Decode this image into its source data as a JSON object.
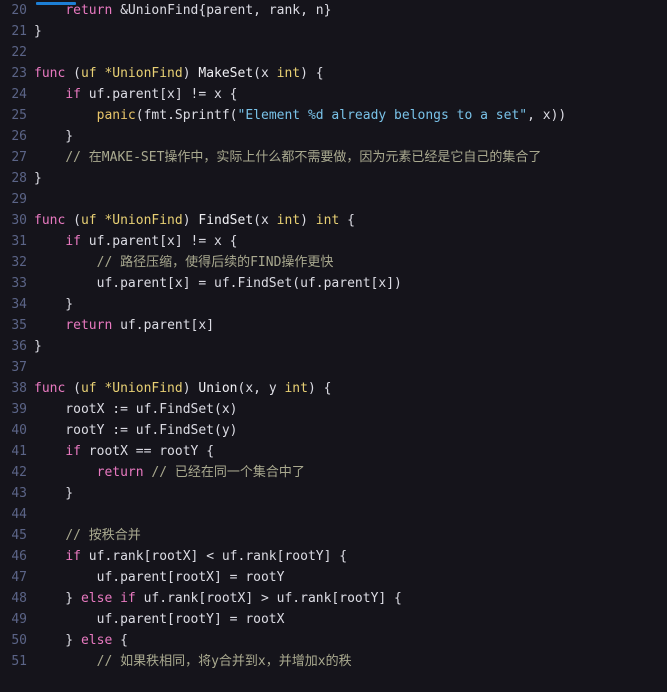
{
  "editor": {
    "language": "go",
    "theme": "dark",
    "colors": {
      "background": "#15141b",
      "line_number": "#5b6487",
      "keyword": "#e879c0",
      "type": "#e8d074",
      "builtin_function": "#e8c56a",
      "string": "#79c2e8",
      "comment": "#a9a98f",
      "plain": "#dcdce4",
      "marker_bar": "#1d7fd6"
    },
    "first_visible_line": 20,
    "last_visible_line": 51
  },
  "lines": [
    {
      "n": "20",
      "tokens": [
        {
          "t": "    ",
          "c": "pln"
        },
        {
          "t": "return",
          "c": "kw"
        },
        {
          "t": " &UnionFind{parent, rank, n}",
          "c": "pln"
        }
      ]
    },
    {
      "n": "21",
      "tokens": [
        {
          "t": "}",
          "c": "pln"
        }
      ]
    },
    {
      "n": "22",
      "tokens": []
    },
    {
      "n": "23",
      "tokens": [
        {
          "t": "func",
          "c": "kw"
        },
        {
          "t": " (",
          "c": "pln"
        },
        {
          "t": "uf *UnionFind",
          "c": "typ"
        },
        {
          "t": ") ",
          "c": "pln"
        },
        {
          "t": "MakeSet",
          "c": "fn"
        },
        {
          "t": "(x ",
          "c": "pln"
        },
        {
          "t": "int",
          "c": "typ"
        },
        {
          "t": ") {",
          "c": "pln"
        }
      ]
    },
    {
      "n": "24",
      "tokens": [
        {
          "t": "    ",
          "c": "pln"
        },
        {
          "t": "if",
          "c": "kw"
        },
        {
          "t": " uf.parent[x] != x {",
          "c": "pln"
        }
      ]
    },
    {
      "n": "25",
      "tokens": [
        {
          "t": "        ",
          "c": "pln"
        },
        {
          "t": "panic",
          "c": "bfn"
        },
        {
          "t": "(fmt.Sprintf(",
          "c": "pln"
        },
        {
          "t": "\"Element %d already belongs to a set\"",
          "c": "str"
        },
        {
          "t": ", x))",
          "c": "pln"
        }
      ]
    },
    {
      "n": "26",
      "tokens": [
        {
          "t": "    }",
          "c": "pln"
        }
      ]
    },
    {
      "n": "27",
      "tokens": [
        {
          "t": "    ",
          "c": "pln"
        },
        {
          "t": "// 在MAKE-SET操作中，实际上什么都不需要做，因为元素已经是它自己的集合了",
          "c": "cmt"
        }
      ]
    },
    {
      "n": "28",
      "tokens": [
        {
          "t": "}",
          "c": "pln"
        }
      ]
    },
    {
      "n": "29",
      "tokens": []
    },
    {
      "n": "30",
      "tokens": [
        {
          "t": "func",
          "c": "kw"
        },
        {
          "t": " (",
          "c": "pln"
        },
        {
          "t": "uf *UnionFind",
          "c": "typ"
        },
        {
          "t": ") ",
          "c": "pln"
        },
        {
          "t": "FindSet",
          "c": "fn"
        },
        {
          "t": "(x ",
          "c": "pln"
        },
        {
          "t": "int",
          "c": "typ"
        },
        {
          "t": ") ",
          "c": "pln"
        },
        {
          "t": "int",
          "c": "typ"
        },
        {
          "t": " {",
          "c": "pln"
        }
      ]
    },
    {
      "n": "31",
      "tokens": [
        {
          "t": "    ",
          "c": "pln"
        },
        {
          "t": "if",
          "c": "kw"
        },
        {
          "t": " uf.parent[x] != x {",
          "c": "pln"
        }
      ]
    },
    {
      "n": "32",
      "tokens": [
        {
          "t": "        ",
          "c": "pln"
        },
        {
          "t": "// 路径压缩，使得后续的FIND操作更快",
          "c": "cmt"
        }
      ]
    },
    {
      "n": "33",
      "tokens": [
        {
          "t": "        uf.parent[x] = uf.FindSet(uf.parent[x])",
          "c": "pln"
        }
      ]
    },
    {
      "n": "34",
      "tokens": [
        {
          "t": "    }",
          "c": "pln"
        }
      ]
    },
    {
      "n": "35",
      "tokens": [
        {
          "t": "    ",
          "c": "pln"
        },
        {
          "t": "return",
          "c": "kw"
        },
        {
          "t": " uf.parent[x]",
          "c": "pln"
        }
      ]
    },
    {
      "n": "36",
      "tokens": [
        {
          "t": "}",
          "c": "pln"
        }
      ]
    },
    {
      "n": "37",
      "tokens": []
    },
    {
      "n": "38",
      "tokens": [
        {
          "t": "func",
          "c": "kw"
        },
        {
          "t": " (",
          "c": "pln"
        },
        {
          "t": "uf *UnionFind",
          "c": "typ"
        },
        {
          "t": ") ",
          "c": "pln"
        },
        {
          "t": "Union",
          "c": "fn"
        },
        {
          "t": "(x, y ",
          "c": "pln"
        },
        {
          "t": "int",
          "c": "typ"
        },
        {
          "t": ") {",
          "c": "pln"
        }
      ]
    },
    {
      "n": "39",
      "tokens": [
        {
          "t": "    rootX := uf.FindSet(x)",
          "c": "pln"
        }
      ]
    },
    {
      "n": "40",
      "tokens": [
        {
          "t": "    rootY := uf.FindSet(y)",
          "c": "pln"
        }
      ]
    },
    {
      "n": "41",
      "tokens": [
        {
          "t": "    ",
          "c": "pln"
        },
        {
          "t": "if",
          "c": "kw"
        },
        {
          "t": " rootX == rootY {",
          "c": "pln"
        }
      ]
    },
    {
      "n": "42",
      "tokens": [
        {
          "t": "        ",
          "c": "pln"
        },
        {
          "t": "return",
          "c": "kw"
        },
        {
          "t": " ",
          "c": "pln"
        },
        {
          "t": "// 已经在同一个集合中了",
          "c": "cmt"
        }
      ]
    },
    {
      "n": "43",
      "tokens": [
        {
          "t": "    }",
          "c": "pln"
        }
      ]
    },
    {
      "n": "44",
      "tokens": []
    },
    {
      "n": "45",
      "tokens": [
        {
          "t": "    ",
          "c": "pln"
        },
        {
          "t": "// 按秩合并",
          "c": "cmt"
        }
      ]
    },
    {
      "n": "46",
      "tokens": [
        {
          "t": "    ",
          "c": "pln"
        },
        {
          "t": "if",
          "c": "kw"
        },
        {
          "t": " uf.rank[rootX] < uf.rank[rootY] {",
          "c": "pln"
        }
      ]
    },
    {
      "n": "47",
      "tokens": [
        {
          "t": "        uf.parent[rootX] = rootY",
          "c": "pln"
        }
      ]
    },
    {
      "n": "48",
      "tokens": [
        {
          "t": "    } ",
          "c": "pln"
        },
        {
          "t": "else",
          "c": "kw"
        },
        {
          "t": " ",
          "c": "pln"
        },
        {
          "t": "if",
          "c": "kw"
        },
        {
          "t": " uf.rank[rootX] > uf.rank[rootY] {",
          "c": "pln"
        }
      ]
    },
    {
      "n": "49",
      "tokens": [
        {
          "t": "        uf.parent[rootY] = rootX",
          "c": "pln"
        }
      ]
    },
    {
      "n": "50",
      "tokens": [
        {
          "t": "    } ",
          "c": "pln"
        },
        {
          "t": "else",
          "c": "kw"
        },
        {
          "t": " {",
          "c": "pln"
        }
      ]
    },
    {
      "n": "51",
      "tokens": [
        {
          "t": "        ",
          "c": "pln"
        },
        {
          "t": "// 如果秩相同，将y合并到x，并增加x的秩",
          "c": "cmt"
        }
      ]
    }
  ]
}
